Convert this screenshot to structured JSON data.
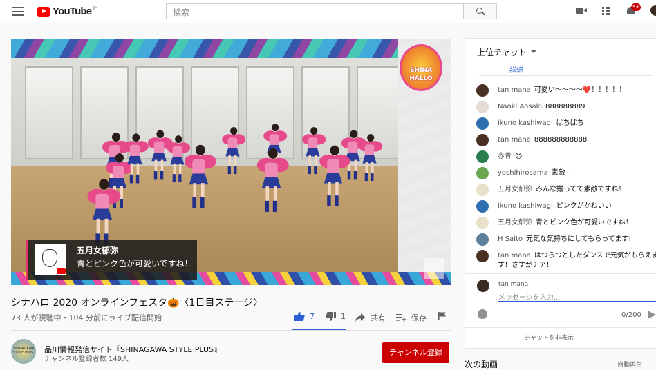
{
  "header": {
    "logo_text": "YouTube",
    "logo_region": "JP",
    "search_placeholder": "検索",
    "notification_count": "9+"
  },
  "video_overlay": {
    "caption_name": "五月女郁弥",
    "caption_message": "青とピンク色が可愛いですね！",
    "logo_line1": "SHINA",
    "logo_line2": "HALLO",
    "watermark": "SHINAGAWA STYLE PLUS"
  },
  "video": {
    "title": "シナハロ 2020 オンラインフェスタ🎃〈1日目ステージ〉",
    "meta": "73 人が視聴中・104 分前にライブ配信開始",
    "likes": "7",
    "dislikes": "1",
    "share_label": "共有",
    "save_label": "保存"
  },
  "channel": {
    "name": "品川情報発信サイト『SHINAGAWA STYLE PLUS』",
    "subscribers": "チャンネル登録者数 149人",
    "subscribe_label": "チャンネル登録",
    "avatar_text": "SHINAGAWA STYLE PLUS"
  },
  "chat": {
    "header_title": "上位チャット",
    "pinned_link": "詳細",
    "messages": [
      {
        "author": "tan mana",
        "text": "可愛い〜〜〜〜❤️！！！！！",
        "avatar_color": "#4a3022"
      },
      {
        "author": "Naoki Aosaki",
        "text": "888888889",
        "avatar_color": "#e5dcd6"
      },
      {
        "author": "ikuno kashiwagi",
        "text": "ぱちぱち",
        "avatar_color": "#2f6fb0"
      },
      {
        "author": "tan mana",
        "text": "888888888888",
        "avatar_color": "#4a3022"
      },
      {
        "author": "赤青",
        "text": "😊",
        "avatar_color": "#2a7d4f"
      },
      {
        "author": "yoshihirosama",
        "text": "素敵—",
        "avatar_color": "#6aa84f"
      },
      {
        "author": "五月女郁弥",
        "text": "みんな揃ってて素敵ですね！",
        "avatar_color": "#e8e0c8"
      },
      {
        "author": "ikuno kashiwagi",
        "text": "ピンクがかわいい",
        "avatar_color": "#2f6fb0"
      },
      {
        "author": "五月女郁弥",
        "text": "青とピンク色が可愛いですね！",
        "avatar_color": "#e8e0c8"
      },
      {
        "author": "H Saito",
        "text": "元気な気持ちにしてもらってます!",
        "avatar_color": "#5f7f9a"
      },
      {
        "author": "tan mana",
        "text": "はつらつとしたダンスで元気がもらえます！さすがチア！",
        "avatar_color": "#4a3022"
      }
    ],
    "composer_name": "tan mana",
    "composer_placeholder": "メッセージを入力...",
    "char_count": "0/200",
    "hide_chat_label": "チャットを非表示"
  },
  "sidebar": {
    "next_label": "次の動画",
    "autoplay_label": "自動再生"
  }
}
